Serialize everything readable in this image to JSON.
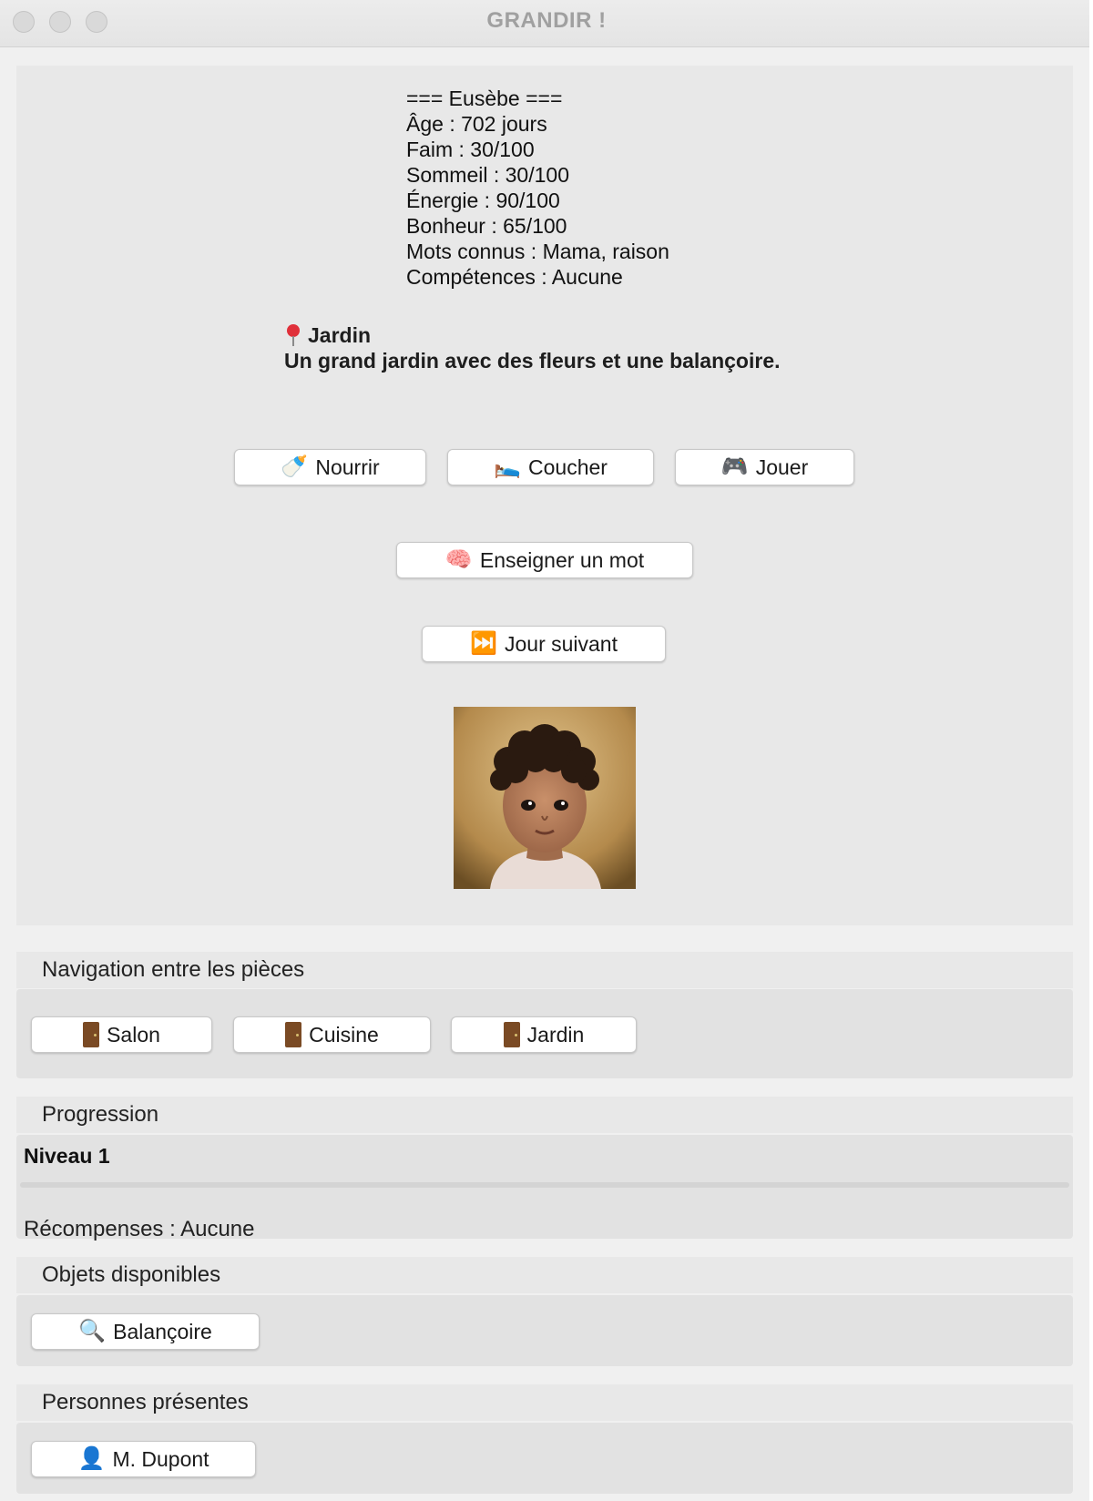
{
  "window": {
    "title": "GRANDIR !"
  },
  "stats": {
    "header": "=== Eusèbe ===",
    "age": "Âge : 702 jours",
    "faim": "Faim : 30/100",
    "sommeil": "Sommeil : 30/100",
    "energie": "Énergie : 90/100",
    "bonheur": "Bonheur : 65/100",
    "mots": "Mots connus : Mama, raison",
    "competences": "Compétences : Aucune"
  },
  "location": {
    "name": "Jardin",
    "description": "Un grand jardin avec des fleurs et une balançoire.",
    "icon": "pin-icon"
  },
  "actions": {
    "nourrir": {
      "label": "Nourrir",
      "icon": "🍼"
    },
    "coucher": {
      "label": "Coucher",
      "icon": "🛌"
    },
    "jouer": {
      "label": "Jouer",
      "icon": "🎮"
    },
    "enseigner": {
      "label": "Enseigner un mot",
      "icon": "🧠"
    },
    "jour_suivant": {
      "label": "Jour suivant",
      "icon": "⏭️"
    }
  },
  "navigation": {
    "title": "Navigation entre les pièces",
    "rooms": [
      {
        "label": "Salon",
        "icon": "door-icon"
      },
      {
        "label": "Cuisine",
        "icon": "door-icon"
      },
      {
        "label": "Jardin",
        "icon": "door-icon"
      }
    ]
  },
  "progression": {
    "title": "Progression",
    "level": "Niveau 1",
    "progress_fraction": 0,
    "rewards": "Récompenses : Aucune"
  },
  "objects": {
    "title": "Objets disponibles",
    "items": [
      {
        "label": "Balançoire",
        "icon": "🔍"
      }
    ]
  },
  "people": {
    "title": "Personnes présentes",
    "items": [
      {
        "label": "M. Dupont",
        "icon": "👤"
      }
    ]
  }
}
